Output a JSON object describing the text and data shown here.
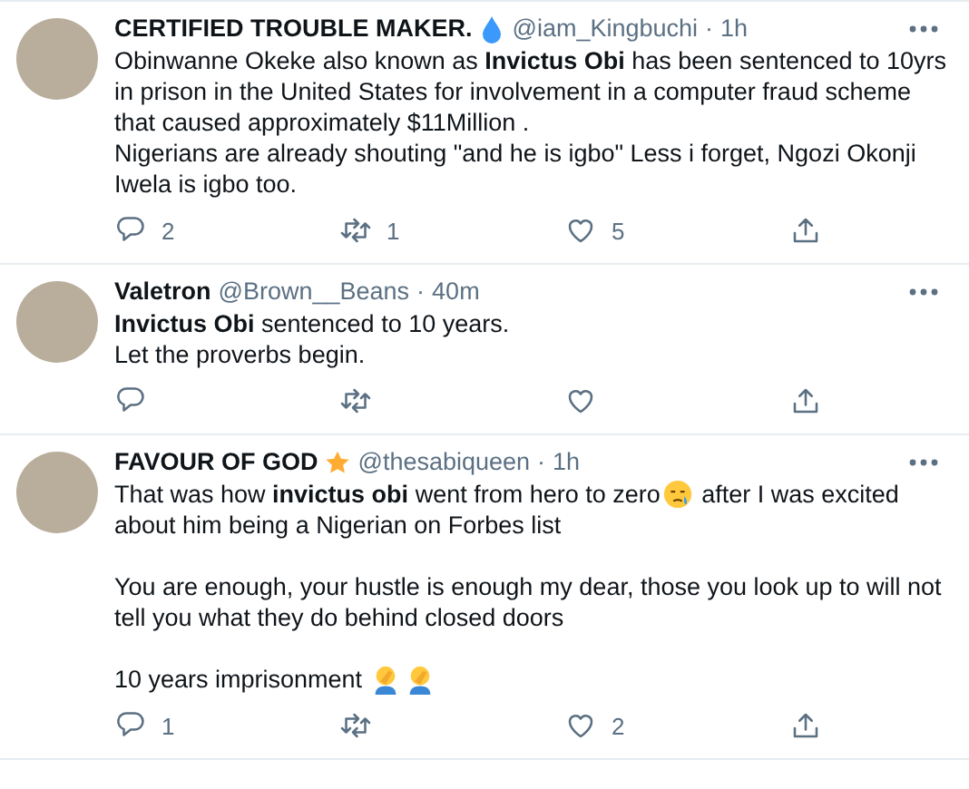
{
  "tweets": [
    {
      "name": "CERTIFIED TROUBLE MAKER.",
      "name_badge": {
        "kind": "droplet"
      },
      "handle": "@iam_Kingbuchi",
      "separator": "·",
      "time": "1h",
      "blocks": [
        {
          "lines": [
            {
              "parts": [
                {
                  "kind": "text",
                  "text": "Obinwanne Okeke also known as **Invictus Obi** has been sentenced to 10yrs in prison in the United States for involvement in a computer fraud scheme that caused approximately $11Million ."
                }
              ]
            },
            {
              "parts": [
                {
                  "kind": "text",
                  "text": "Nigerians are already shouting \"and he is igbo\" Less i forget, Ngozi Okonji Iwela is igbo too."
                }
              ]
            }
          ]
        }
      ],
      "actions": [
        {
          "kind": "reply",
          "count": "2"
        },
        {
          "kind": "retweet",
          "count": "1"
        },
        {
          "kind": "like",
          "count": "5"
        },
        {
          "kind": "share"
        }
      ]
    },
    {
      "name": "Valetron",
      "handle": "@Brown__Beans",
      "separator": "·",
      "time": "40m",
      "blocks": [
        {
          "lines": [
            {
              "parts": [
                {
                  "kind": "text",
                  "text": "**Invictus Obi** sentenced to 10 years."
                }
              ]
            },
            {
              "parts": [
                {
                  "kind": "text",
                  "text": "Let the proverbs begin."
                }
              ]
            }
          ]
        }
      ],
      "actions": [
        {
          "kind": "reply"
        },
        {
          "kind": "retweet"
        },
        {
          "kind": "like"
        },
        {
          "kind": "share"
        }
      ]
    },
    {
      "name": "FAVOUR OF GOD",
      "name_badge": {
        "kind": "star"
      },
      "handle": "@thesabiqueen",
      "separator": "·",
      "time": "1h",
      "blocks": [
        {
          "lines": [
            {
              "parts": [
                {
                  "kind": "text",
                  "text": "That was how **invictus obi** went from hero to zero"
                },
                {
                  "kind": "sadface"
                },
                {
                  "kind": "text",
                  "text": " after I was excited about him being a Nigerian on Forbes list"
                }
              ]
            }
          ]
        },
        {
          "lines": [
            {
              "parts": [
                {
                  "kind": "text",
                  "text": "You are enough, your hustle is enough my dear, those you look up to will not tell you what they do behind closed doors"
                }
              ]
            }
          ]
        },
        {
          "lines": [
            {
              "parts": [
                {
                  "kind": "text",
                  "text": "10 years imprisonment "
                },
                {
                  "kind": "facepalm"
                },
                {
                  "kind": "facepalm"
                }
              ]
            }
          ]
        }
      ],
      "actions": [
        {
          "kind": "reply",
          "count": "1"
        },
        {
          "kind": "retweet"
        },
        {
          "kind": "like",
          "count": "2"
        },
        {
          "kind": "share"
        }
      ]
    }
  ]
}
